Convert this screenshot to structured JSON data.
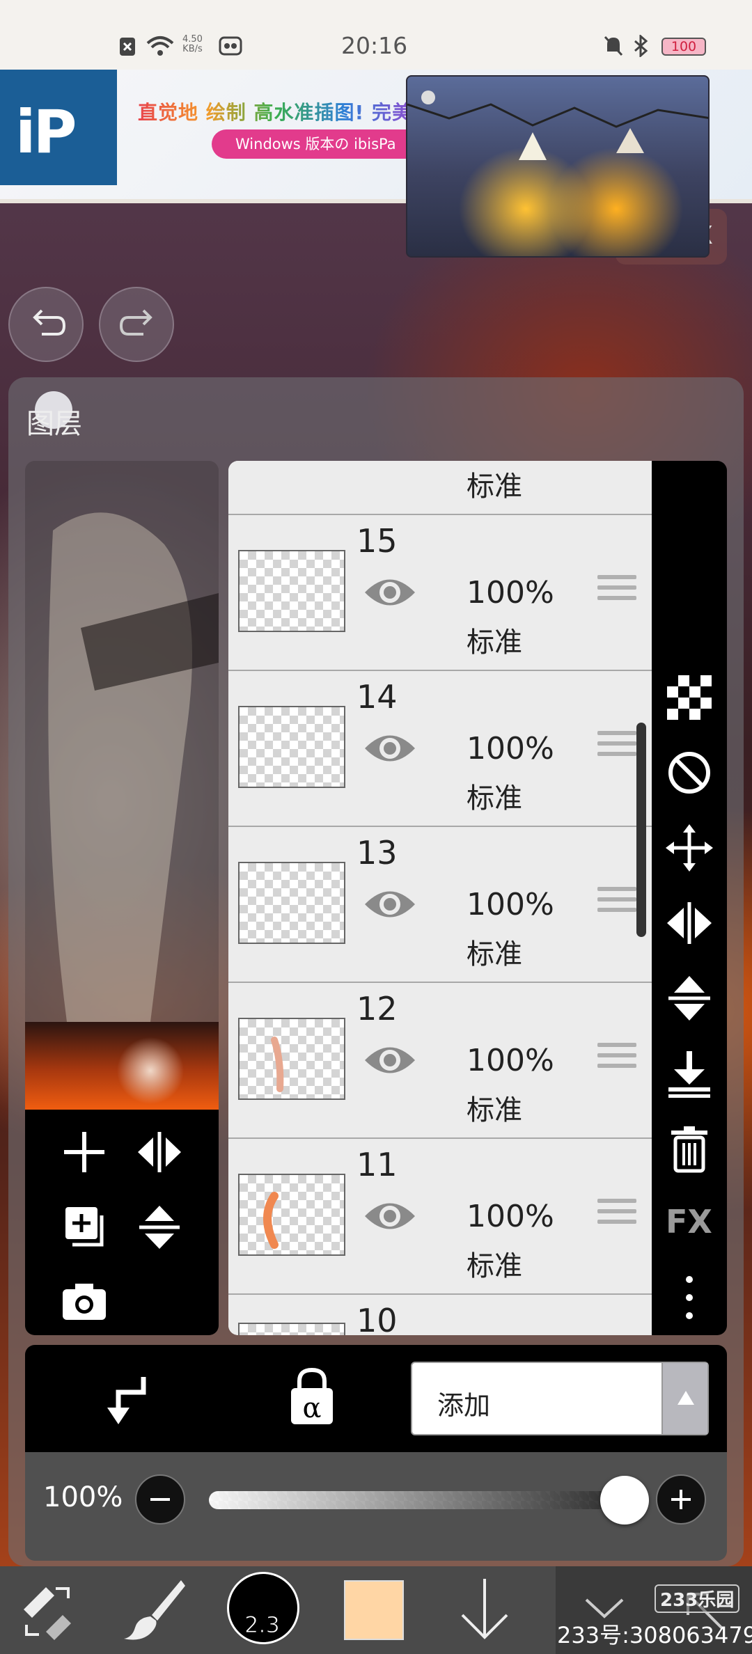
{
  "status_bar": {
    "time": "20:16",
    "net_speed": "4.50\nKB/s",
    "battery": "100"
  },
  "ad": {
    "logo_text": "iP",
    "headline": "直觉地 绘制 高水准插图! 完美",
    "pill": "Windows 版本の ibisPa"
  },
  "video": {
    "close_label": "X"
  },
  "layers_panel": {
    "title": "图层",
    "layers": [
      {
        "number": "",
        "opacity": "",
        "mode": "标准"
      },
      {
        "number": "15",
        "opacity": "100%",
        "mode": "标准"
      },
      {
        "number": "14",
        "opacity": "100%",
        "mode": "标准"
      },
      {
        "number": "13",
        "opacity": "100%",
        "mode": "标准"
      },
      {
        "number": "12",
        "opacity": "100%",
        "mode": "标准"
      },
      {
        "number": "11",
        "opacity": "100%",
        "mode": "标准"
      },
      {
        "number": "10",
        "opacity": "",
        "mode": ""
      }
    ],
    "right_tools": {
      "fx_label": "FX"
    }
  },
  "blend": {
    "mode": "添加"
  },
  "opacity": {
    "label": "100%",
    "value_percent": 100
  },
  "toolbar": {
    "brush_size": "2.3",
    "color": "#ffd6a5"
  },
  "watermark": {
    "logo": "233乐园",
    "id": "233号:308063479"
  },
  "colors": {
    "accent": "#1b5e96",
    "panel_black": "#000000",
    "list_bg": "#e6e6e6"
  }
}
